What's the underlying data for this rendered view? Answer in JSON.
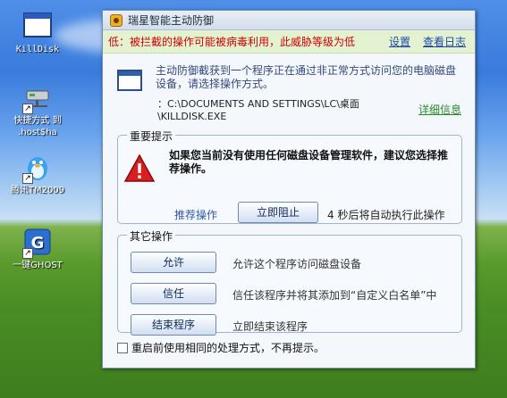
{
  "desktop": {
    "icons": [
      {
        "label": "KillDisk"
      },
      {
        "label": "快捷方式 到 .host$ha"
      },
      {
        "label": "腾讯TM2009"
      },
      {
        "label": "一键GHOST"
      }
    ]
  },
  "dialog": {
    "title": "瑞星智能主动防御",
    "warning": "低：被拦截的操作可能被病毒利用，此威胁等级为低",
    "settings_link": "设置",
    "log_link": "查看日志",
    "info_text": "主动防御截获到一个程序正在通过非正常方式访问您的电脑磁盘设备，请选择操作方式。",
    "path": "：C:\\DOCUMENTS AND SETTINGS\\LC\\桌面\\KILLDISK.EXE",
    "detail_link": "详细信息",
    "important": {
      "title": "重要提示",
      "text": "如果您当前没有使用任何磁盘设备管理软件，建议您选择推荐操作。",
      "recommend_label": "推荐操作",
      "block_button": "立即阻止",
      "countdown": "4 秒后将自动执行此操作"
    },
    "other": {
      "title": "其它操作",
      "options": [
        {
          "button": "允许",
          "desc": "允许这个程序访问磁盘设备"
        },
        {
          "button": "信任",
          "desc": "信任该程序并将其添加到“自定义白名单”中"
        },
        {
          "button": "结束程序",
          "desc": "立即结束该程序"
        }
      ]
    },
    "remember_text": "重启前使用相同的处理方式，不再提示。",
    "remember_checked": false
  }
}
